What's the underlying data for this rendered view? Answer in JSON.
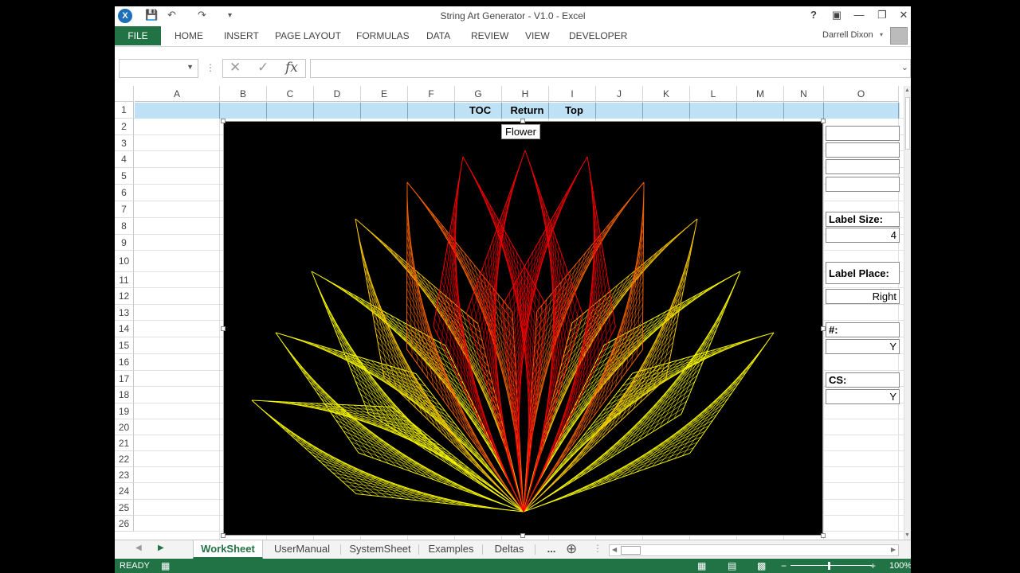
{
  "titlebar": {
    "title": "String Art Generator - V1.0 - Excel",
    "help": "?",
    "app_icon": "excel-icon",
    "save_icon": "save-icon",
    "undo_icon": "undo-icon",
    "redo_icon": "redo-icon"
  },
  "ribbon": {
    "file": "FILE",
    "tabs": [
      "HOME",
      "INSERT",
      "PAGE LAYOUT",
      "FORMULAS",
      "DATA",
      "REVIEW",
      "VIEW",
      "DEVELOPER"
    ],
    "user": "Darrell Dixon"
  },
  "formula_bar": {
    "name_box": "",
    "fx": "fx",
    "value": ""
  },
  "columns": [
    "A",
    "B",
    "C",
    "D",
    "E",
    "F",
    "G",
    "H",
    "I",
    "J",
    "K",
    "L",
    "M",
    "N",
    "O"
  ],
  "rows": [
    "1",
    "2",
    "3",
    "4",
    "5",
    "6",
    "7",
    "8",
    "9",
    "10",
    "11",
    "12",
    "13",
    "14",
    "15",
    "16",
    "17",
    "18",
    "19",
    "20",
    "21",
    "22",
    "23",
    "24",
    "25",
    "26"
  ],
  "row1_links": {
    "toc": "TOC",
    "return": "Return",
    "top": "Top"
  },
  "panel": {
    "label_size_label": "Label Size:",
    "label_size_value": "4",
    "label_place_label": "Label Place:",
    "label_place_value": "Right",
    "number_label": "#:",
    "number_value": "Y",
    "cs_label": "CS:",
    "cs_value": "Y"
  },
  "chart": {
    "title": "Flower",
    "background": "#000000",
    "colors": [
      "#ff0000",
      "#ff6600",
      "#ffcc00",
      "#ffff00"
    ]
  },
  "sheet_tabs": {
    "active": "WorkSheet",
    "others": [
      "UserManual",
      "SystemSheet",
      "Examples",
      "Deltas"
    ],
    "more": "..."
  },
  "status": {
    "text": "READY",
    "zoom": "100%"
  },
  "colors": {
    "accent": "#217346",
    "row1": "#bfe1f6"
  }
}
